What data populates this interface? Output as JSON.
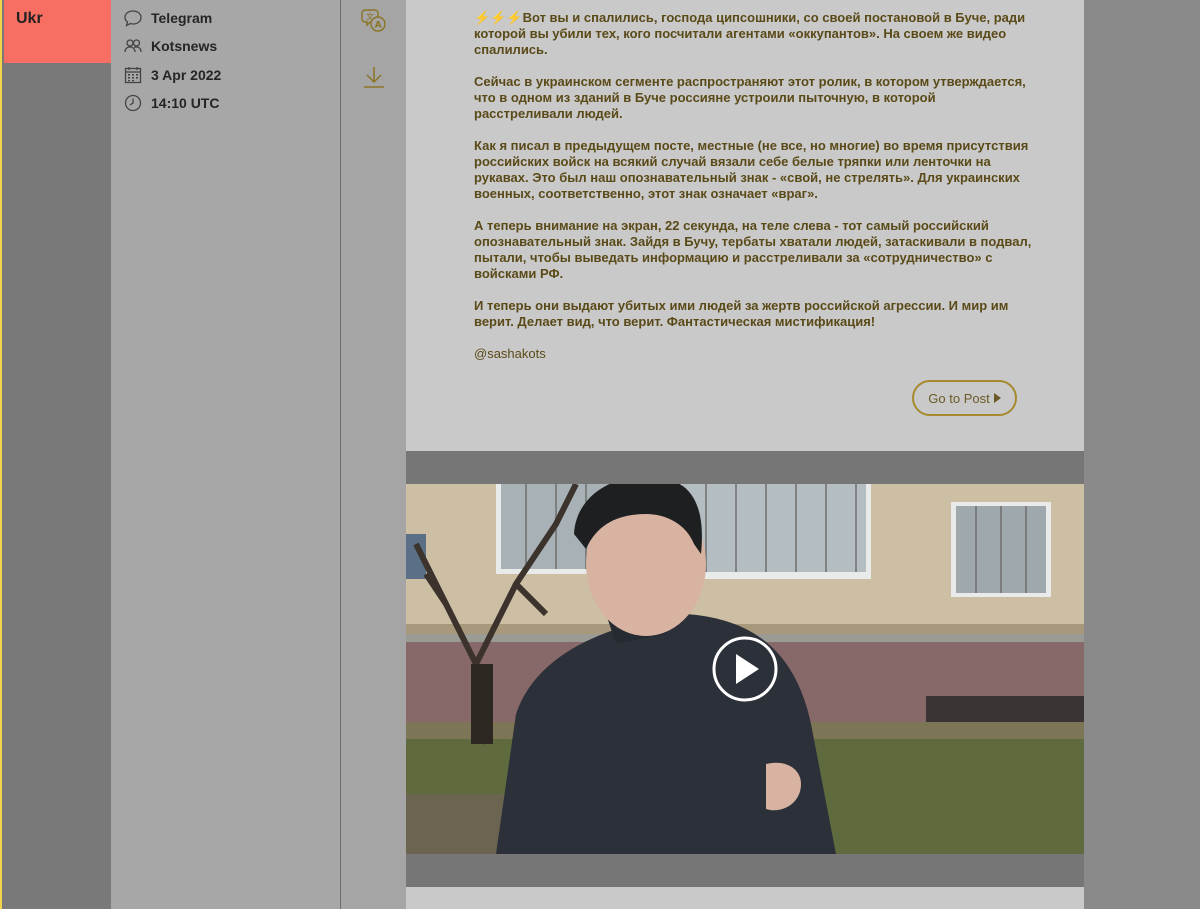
{
  "sidebar": {
    "language_tab": "Ukr"
  },
  "meta": {
    "platform": "Telegram",
    "channel": "Kotsnews",
    "date": "3 Apr 2022",
    "time": "14:10 UTC"
  },
  "actions": {
    "translate_icon": "translate-icon",
    "download_icon": "download-icon"
  },
  "post": {
    "bolts": "⚡⚡⚡",
    "paragraph_1": "Вот вы и спалились, господа ципсошники, со своей постановой в Буче, ради которой вы убили тех, кого посчитали агентами «оккупантов». На своем же видео спалились.",
    "paragraph_2": "Сейчас в украинском сегменте распространяют этот ролик, в котором утверждается, что в одном из зданий в Буче россияне устроили пыточную, в которой расстреливали людей.",
    "paragraph_3": "Как я писал в предыдущем посте, местные (не все, но многие) во время присутствия российских войск на всякий случай вязали себе белые тряпки или ленточки на рукавах. Это был наш опознавательный знак - «свой, не стрелять». Для украинских военных, соответственно, этот знак означает «враг».",
    "paragraph_4": "А теперь внимание на экран, 22 секунда, на теле слева - тот самый российский опознавательный знак. Зайдя в Бучу, тербаты хватали людей, затаскивали в подвал, пытали, чтобы выведать информацию и расстреливали за «сотрудничество» с войсками РФ.",
    "paragraph_5": "И теперь они выдают убитых ими людей за жертв российской агрессии. И мир им верит. Делает вид, что верит. Фантастическая мистификация!",
    "handle": "@sashakots",
    "go_to_post": "Go to Post"
  },
  "video": {
    "play_icon": "play-icon"
  },
  "colors": {
    "accent_tab": "#f76e63",
    "text_gold": "#5a4a18",
    "button_border": "#a58a2e"
  }
}
